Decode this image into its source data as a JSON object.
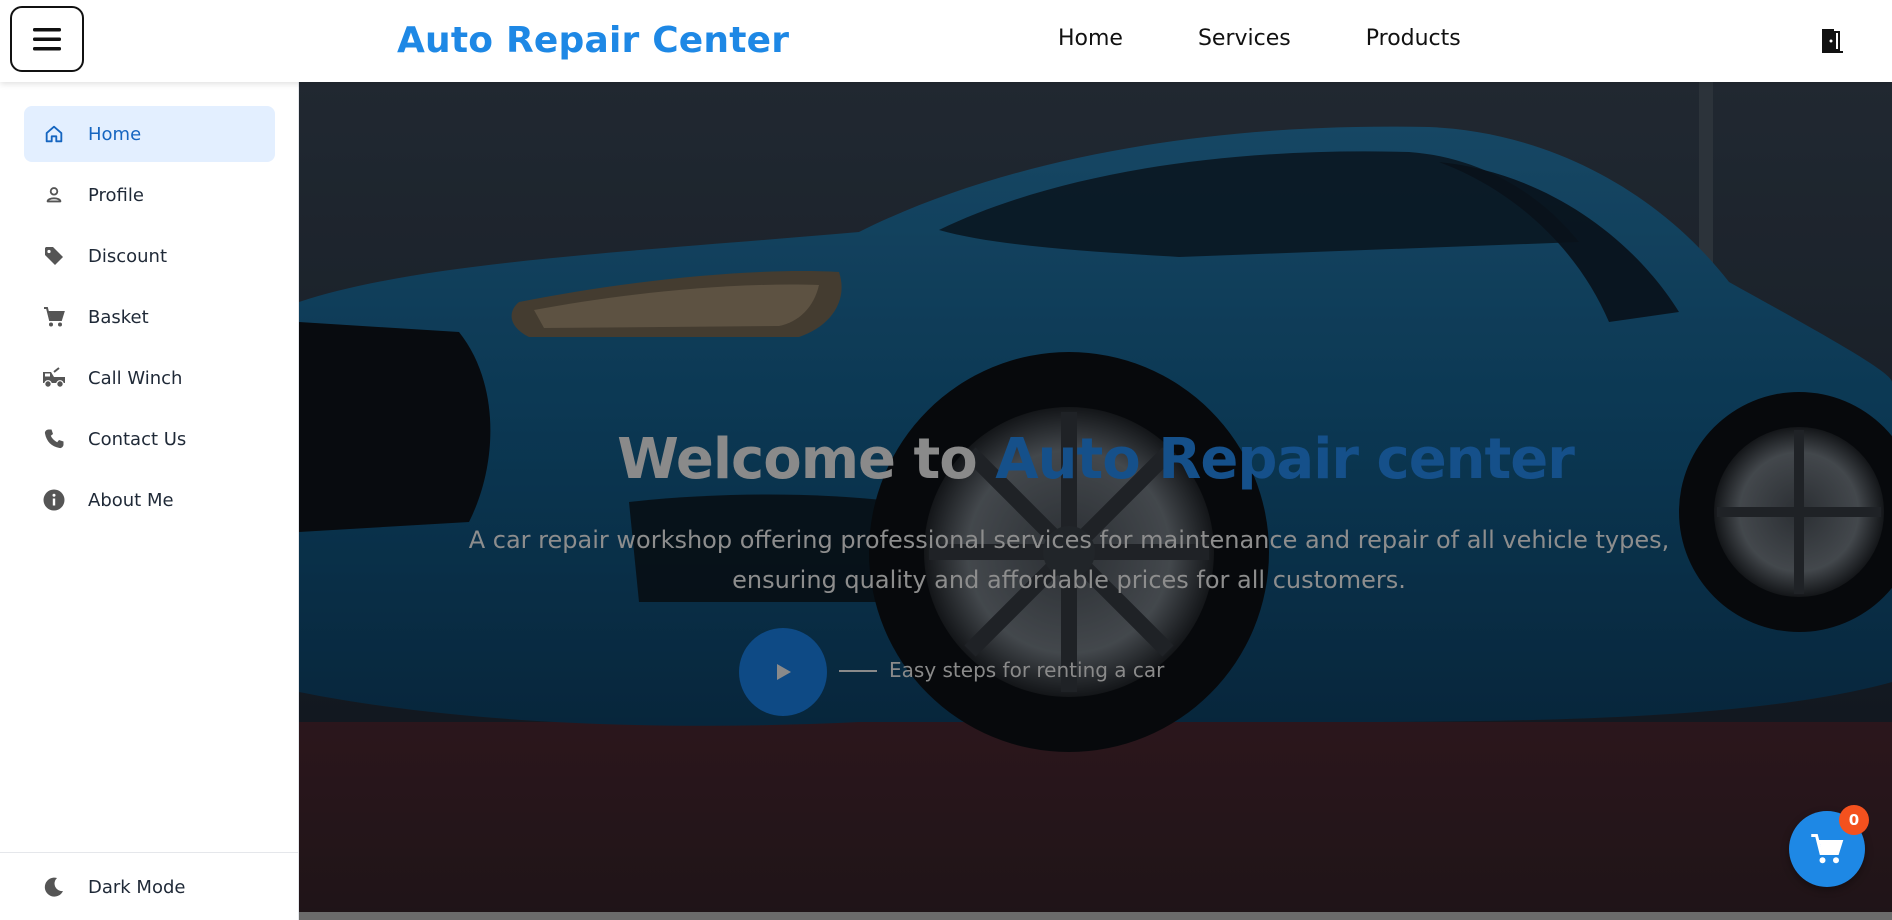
{
  "header": {
    "brand": "Auto Repair Center",
    "nav": [
      "Home",
      "Services",
      "Products"
    ],
    "menu_icon": "hamburger-icon",
    "logout_icon": "door-exit-icon"
  },
  "sidebar": {
    "items": [
      {
        "label": "Home",
        "icon": "home-icon",
        "active": true
      },
      {
        "label": "Profile",
        "icon": "person-icon",
        "active": false
      },
      {
        "label": "Discount",
        "icon": "tag-icon",
        "active": false
      },
      {
        "label": "Basket",
        "icon": "cart-icon",
        "active": false
      },
      {
        "label": "Call Winch",
        "icon": "tow-truck-icon",
        "active": false
      },
      {
        "label": "Contact Us",
        "icon": "phone-icon",
        "active": false
      },
      {
        "label": "About Me",
        "icon": "info-icon",
        "active": false
      }
    ],
    "dark_mode_label": "Dark Mode",
    "dark_mode_icon": "moon-icon"
  },
  "hero": {
    "title_part1": "Welcome to ",
    "title_part2": "Auto Repair center",
    "description": "A car repair workshop offering professional services for maintenance and repair of all vehicle types, ensuring quality and affordable prices for all customers.",
    "steps_label": "Easy steps for renting a car",
    "play_icon": "play-icon",
    "background_image": "blue sedan car photo"
  },
  "cart": {
    "count": "0",
    "icon": "cart-icon"
  },
  "colors": {
    "accent": "#1e88e5",
    "active_bg": "#e3efff",
    "badge": "#f4511e"
  }
}
